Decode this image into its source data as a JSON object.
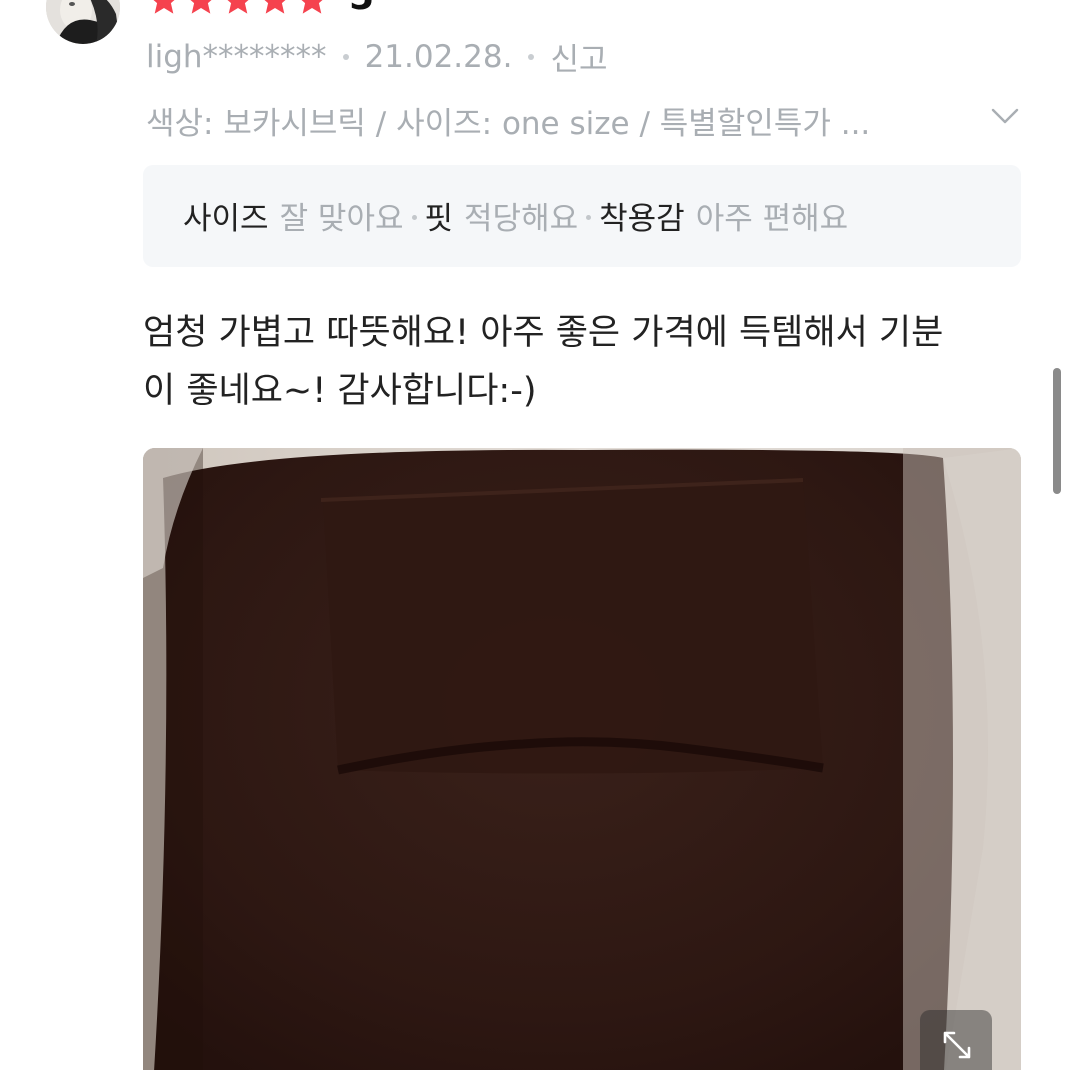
{
  "review": {
    "rating_value": "5",
    "stars_filled": 5,
    "stars_total": 5,
    "star_color": "#f5424e",
    "reviewer": "ligh********",
    "date": "21.02.28.",
    "report_label": "신고",
    "options_text": "색상: 보카시브릭 / 사이즈: one size / 특별할인특가 ...",
    "fit_summary": [
      {
        "label": "사이즈",
        "value": "잘 맞아요"
      },
      {
        "label": "핏",
        "value": "적당해요"
      },
      {
        "label": "착용감",
        "value": "아주 편해요"
      }
    ],
    "body_lines": [
      "엄청 가볍고 따뜻해요! 아주 좋은 가격에 득템해서 기분",
      "이 좋네요~! 감사합니다:-)"
    ]
  },
  "icons": {
    "avatar": "avatar-photo",
    "expand": "expand-icon",
    "chevron": "chevron-down-icon"
  }
}
